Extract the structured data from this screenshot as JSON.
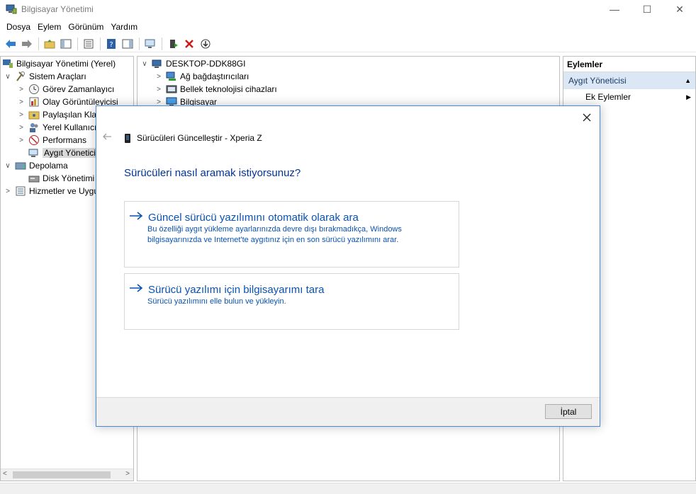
{
  "window": {
    "title": "Bilgisayar Yönetimi",
    "controls": {
      "minimize": "—",
      "maximize": "☐",
      "close": "✕"
    }
  },
  "menu": [
    "Dosya",
    "Eylem",
    "Görünüm",
    "Yardım"
  ],
  "left_tree": {
    "items": [
      {
        "label": "Bilgisayar Yönetimi (Yerel)",
        "level": 0,
        "chev": "",
        "icon": "computer-management-icon"
      },
      {
        "label": "Sistem Araçları",
        "level": 1,
        "chev": "∨",
        "icon": "tools-icon"
      },
      {
        "label": "Görev Zamanlayıcı",
        "level": 2,
        "chev": ">",
        "icon": "clock-icon"
      },
      {
        "label": "Olay Görüntüleyicisi",
        "level": 2,
        "chev": ">",
        "icon": "event-viewer-icon"
      },
      {
        "label": "Paylaşılan Klasörler",
        "level": 2,
        "chev": ">",
        "icon": "shared-folder-icon"
      },
      {
        "label": "Yerel Kullanıcılar ve Gruplar",
        "level": 2,
        "chev": ">",
        "icon": "users-icon"
      },
      {
        "label": "Performans",
        "level": 2,
        "chev": ">",
        "icon": "performance-icon"
      },
      {
        "label": "Aygıt Yöneticisi",
        "level": 2,
        "chev": "",
        "icon": "device-manager-icon",
        "selected": true
      },
      {
        "label": "Depolama",
        "level": 1,
        "chev": "∨",
        "icon": "storage-icon"
      },
      {
        "label": "Disk Yönetimi",
        "level": 2,
        "chev": "",
        "icon": "disk-icon"
      },
      {
        "label": "Hizmetler ve Uygulamalar",
        "level": 1,
        "chev": ">",
        "icon": "services-icon"
      }
    ]
  },
  "center_tree": {
    "root": "DESKTOP-DDK88GI",
    "items": [
      "Ağ bağdaştırıcıları",
      "Bellek teknolojisi cihazları",
      "Bilgisayar"
    ]
  },
  "actions": {
    "header": "Eylemler",
    "section": "Aygıt Yöneticisi",
    "item": "Ek Eylemler"
  },
  "dialog": {
    "header_title": "Sürücüleri Güncelleştir - Xperia Z",
    "question": "Sürücüleri nasıl aramak istiyorsunuz?",
    "option1": {
      "title": "Güncel sürücü yazılımını otomatik olarak ara",
      "desc": "Bu özelliği aygıt yükleme ayarlarınızda devre dışı bırakmadıkça, Windows bilgisayarınızda ve Internet'te aygıtınız için en son sürücü yazılımını arar."
    },
    "option2": {
      "title": "Sürücü yazılımı için bilgisayarımı tara",
      "desc": "Sürücü yazılımını elle bulun ve yükleyin."
    },
    "cancel": "İptal"
  },
  "colors": {
    "accent": "#0a52b3",
    "question": "#003399",
    "dialog_border": "#4a8ad4",
    "actions_section_bg": "#dbe7f5"
  }
}
